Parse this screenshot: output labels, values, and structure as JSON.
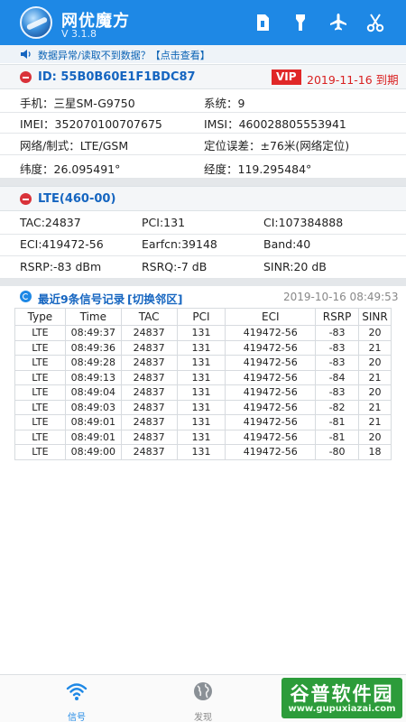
{
  "header": {
    "title": "网优魔方",
    "version": "V 3.1.8",
    "icons": [
      "sim-card-icon",
      "flashlight-icon",
      "airplane-icon",
      "scissors-icon"
    ]
  },
  "notice": {
    "text": "数据异常/读取不到数据？【点击查看】"
  },
  "device": {
    "id_label": "ID:  55B0B60E1F1BDC87",
    "vip_badge": "VIP",
    "expire": "2019-11-16 到期",
    "rows": [
      [
        "手机：三星SM-G9750",
        "系统：9"
      ],
      [
        "IMEI：352070100707675",
        "IMSI：460028805553941"
      ],
      [
        "网络/制式：LTE/GSM",
        "定位误差：±76米(网络定位)"
      ],
      [
        "纬度：26.095491°",
        "经度：119.295484°"
      ]
    ]
  },
  "lte": {
    "title": "LTE(460-00)",
    "rows": [
      [
        "TAC:24837",
        "PCI:131",
        "CI:107384888"
      ],
      [
        "ECI:419472-56",
        "Earfcn:39148",
        "Band:40"
      ],
      [
        "RSRP:-83 dBm",
        "RSRQ:-7 dB",
        "SINR:20 dB"
      ]
    ]
  },
  "records": {
    "title": "最近9条信号记录",
    "link": "[切换邻区]",
    "timestamp": "2019-10-16 08:49:53",
    "columns": [
      "Type",
      "Time",
      "TAC",
      "PCI",
      "ECI",
      "RSRP",
      "SINR"
    ],
    "rows": [
      [
        "LTE",
        "08:49:37",
        "24837",
        "131",
        "419472-56",
        "-83",
        "20"
      ],
      [
        "LTE",
        "08:49:36",
        "24837",
        "131",
        "419472-56",
        "-83",
        "21"
      ],
      [
        "LTE",
        "08:49:28",
        "24837",
        "131",
        "419472-56",
        "-83",
        "20"
      ],
      [
        "LTE",
        "08:49:13",
        "24837",
        "131",
        "419472-56",
        "-84",
        "21"
      ],
      [
        "LTE",
        "08:49:04",
        "24837",
        "131",
        "419472-56",
        "-83",
        "20"
      ],
      [
        "LTE",
        "08:49:03",
        "24837",
        "131",
        "419472-56",
        "-82",
        "21"
      ],
      [
        "LTE",
        "08:49:01",
        "24837",
        "131",
        "419472-56",
        "-81",
        "21"
      ],
      [
        "LTE",
        "08:49:01",
        "24837",
        "131",
        "419472-56",
        "-81",
        "20"
      ],
      [
        "LTE",
        "08:49:00",
        "24837",
        "131",
        "419472-56",
        "-80",
        "18"
      ]
    ]
  },
  "nav": {
    "items": [
      {
        "label": "信号",
        "icon": "wifi-signal-icon",
        "active": true
      },
      {
        "label": "发现",
        "icon": "globe-icon",
        "active": false
      }
    ]
  },
  "watermark": {
    "main": "谷普软件园",
    "url": "www.gupuxiazai.com"
  },
  "colors": {
    "primary": "#1e88e5",
    "danger": "#d9323a",
    "link": "#1565c0",
    "watermark": "#2c9c3a"
  }
}
